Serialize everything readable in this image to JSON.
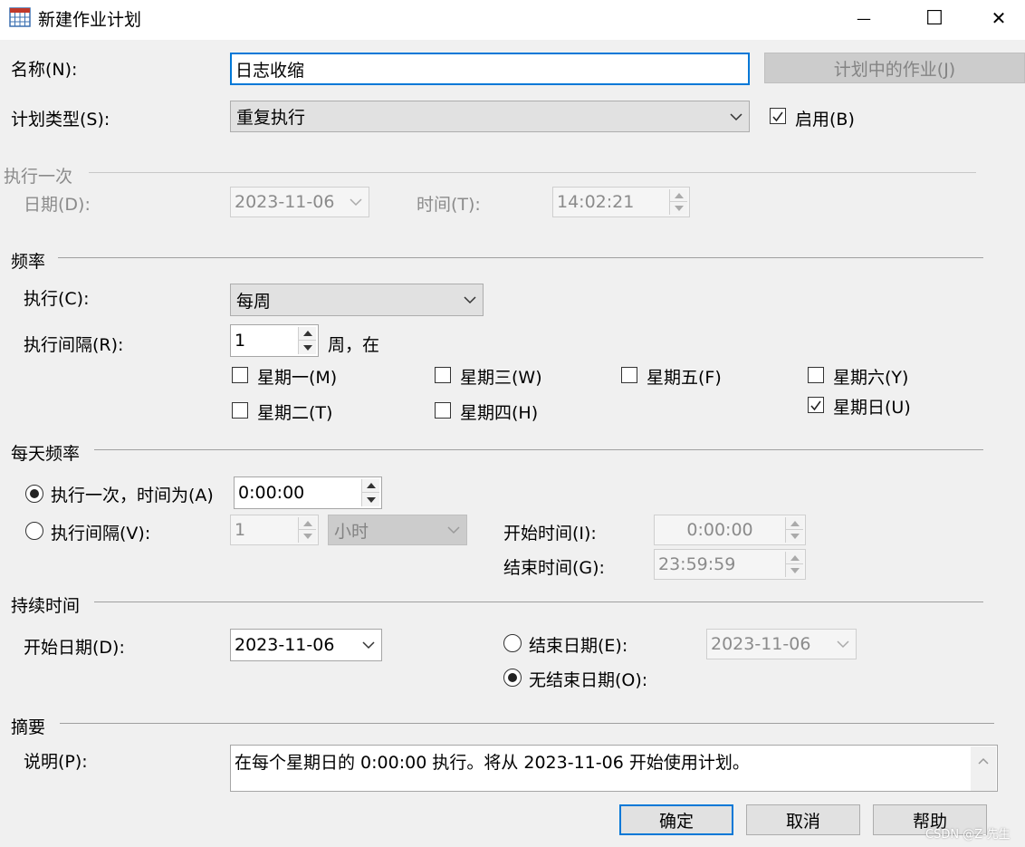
{
  "window": {
    "title": "新建作业计划",
    "minimize_glyph": "—",
    "maximize_glyph": "☐",
    "close_glyph": "✕"
  },
  "top": {
    "name_label": "名称(N):",
    "name_value": "日志收缩",
    "jobs_in_schedule_button": "计划中的作业(J)",
    "schedule_type_label": "计划类型(S):",
    "schedule_type_value": "重复执行",
    "enabled_label": "启用(B)",
    "enabled_checked": true
  },
  "one_time": {
    "group_title": "执行一次",
    "date_label": "日期(D):",
    "date_value": "2023-11-06",
    "time_label": "时间(T):",
    "time_value": "14:02:21"
  },
  "frequency": {
    "group_title": "频率",
    "occurs_label": "执行(C):",
    "occurs_value": "每周",
    "recurs_label": "执行间隔(R):",
    "recurs_value": "1",
    "recurs_suffix": "周，在",
    "days": [
      {
        "label": "星期一(M)",
        "checked": false
      },
      {
        "label": "星期二(T)",
        "checked": false
      },
      {
        "label": "星期三(W)",
        "checked": false
      },
      {
        "label": "星期四(H)",
        "checked": false
      },
      {
        "label": "星期五(F)",
        "checked": false
      },
      {
        "label": "星期六(Y)",
        "checked": false
      },
      {
        "label": "星期日(U)",
        "checked": true
      }
    ]
  },
  "daily": {
    "group_title": "每天频率",
    "once_label": "执行一次，时间为(A)",
    "once_value": "0:00:00",
    "once_selected": true,
    "every_label": "执行间隔(V):",
    "every_value": "1",
    "every_unit": "小时",
    "start_label": "开始时间(I):",
    "start_value": "0:00:00",
    "end_label": "结束时间(G):",
    "end_value": "23:59:59"
  },
  "duration": {
    "group_title": "持续时间",
    "start_date_label": "开始日期(D):",
    "start_date_value": "2023-11-06",
    "end_date_label": "结束日期(E):",
    "end_date_value": "2023-11-06",
    "end_date_selected": false,
    "no_end_label": "无结束日期(O):",
    "no_end_selected": true
  },
  "summary": {
    "group_title": "摘要",
    "description_label": "说明(P):",
    "description_text": "在每个星期日的 0:00:00 执行。将从 2023-11-06 开始使用计划。"
  },
  "buttons": {
    "ok": "确定",
    "cancel": "取消",
    "help": "帮助"
  },
  "watermark": "CSDN @Z-先生",
  "colors": {
    "accent": "#0078d7",
    "disabled_text": "#8b8b8b"
  }
}
